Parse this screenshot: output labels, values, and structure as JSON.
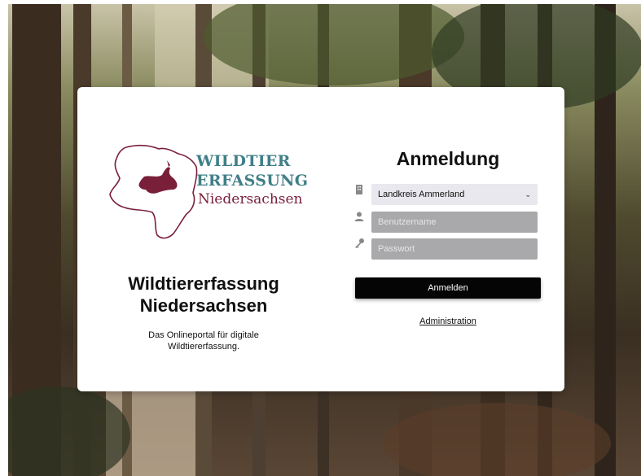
{
  "logo": {
    "line1": "WILDTIER",
    "line2": "ERFASSUNG",
    "line3": "Niedersachsen",
    "teal_color": "#3f7f88",
    "maroon_color": "#7a1f3a"
  },
  "brand": {
    "title": "Wildtiererfassung Niedersachsen",
    "subtitle": "Das Onlineportal für digitale Wildtiererfassung."
  },
  "login": {
    "heading": "Anmeldung",
    "district_selected": "Landkreis Ammerland",
    "username_placeholder": "Benutzername",
    "password_placeholder": "Passwort",
    "submit_label": "Anmelden",
    "admin_link": "Administration"
  },
  "icons": {
    "district": "building-icon",
    "username": "user-icon",
    "password": "key-icon",
    "select": "chevron-down-icon"
  }
}
